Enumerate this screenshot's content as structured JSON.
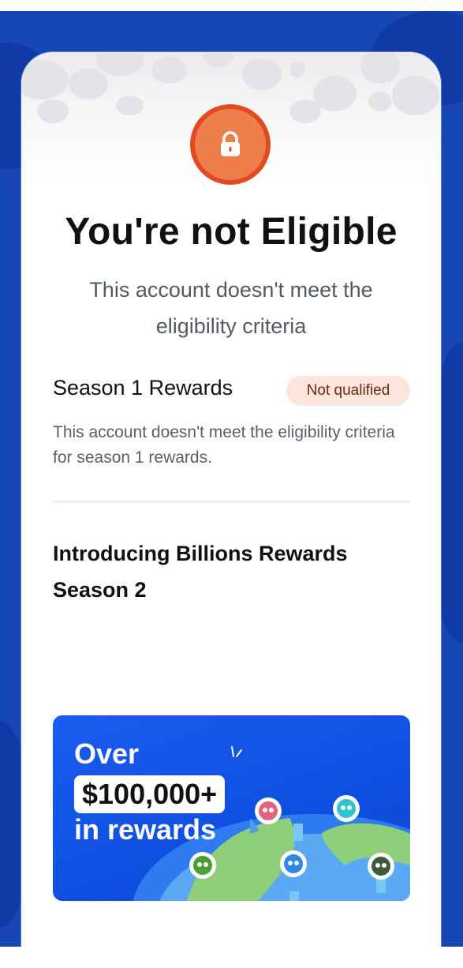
{
  "title": "You're not Eligible",
  "subtitle": "This account doesn't meet the eligibility criteria",
  "season1": {
    "title": "Season 1 Rewards",
    "badge": "Not qualified",
    "description": "This account doesn't meet the eligibility criteria for season 1 rewards."
  },
  "season2": {
    "title": "Introducing Billions Rewards Season 2"
  },
  "banner": {
    "line1": "Over",
    "amount": "$100,000+",
    "line3": "in rewards"
  },
  "colors": {
    "background": "#1746b6",
    "lock_outer": "#e24a22",
    "lock_inner": "#ef7e4d",
    "badge_bg": "#fbe5dc",
    "banner": "#1b5cf0"
  },
  "icons": [
    "lock-icon",
    "sparkle-icon",
    "avatar-icon"
  ]
}
